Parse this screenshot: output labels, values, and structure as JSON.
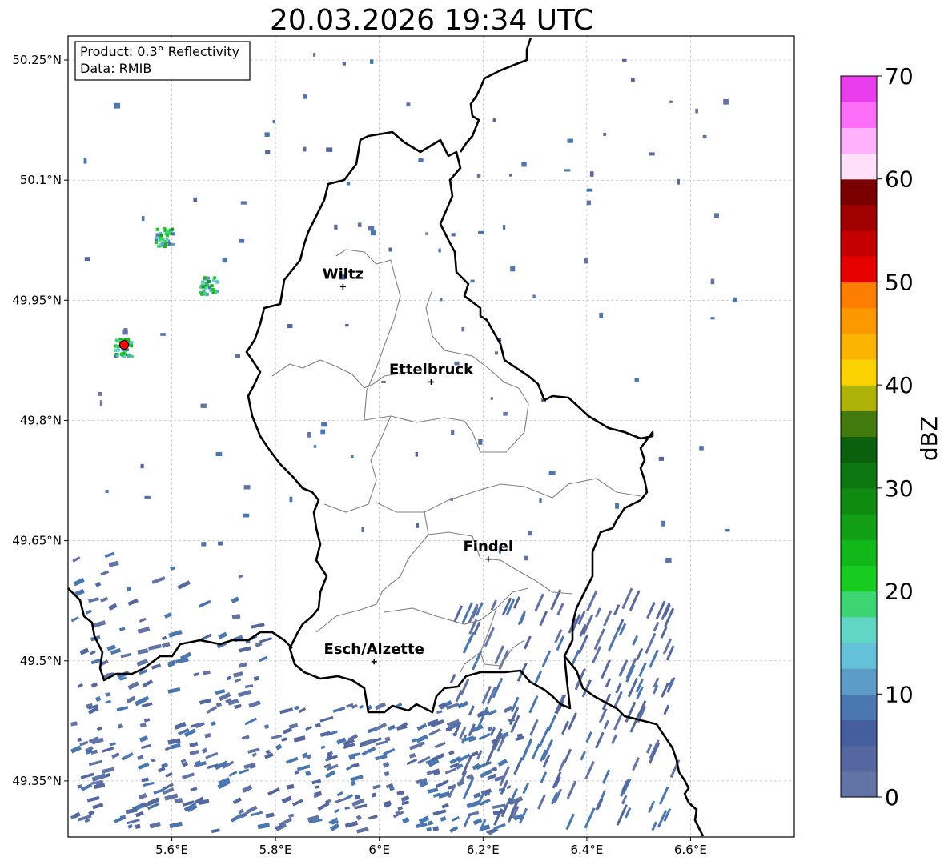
{
  "title": "20.03.2026 19:34 UTC",
  "info_box": {
    "product": "Product: 0.3° Reflectivity",
    "data": "Data: RMIB"
  },
  "map": {
    "lon_range": [
      5.4,
      6.8
    ],
    "lat_range": [
      49.28,
      50.28
    ],
    "lon_ticks": [
      {
        "value": 5.6,
        "label": "5.6°E"
      },
      {
        "value": 5.8,
        "label": "5.8°E"
      },
      {
        "value": 6.0,
        "label": "6°E"
      },
      {
        "value": 6.2,
        "label": "6.2°E"
      },
      {
        "value": 6.4,
        "label": "6.4°E"
      },
      {
        "value": 6.6,
        "label": "6.6°E"
      }
    ],
    "lat_ticks": [
      {
        "value": 50.25,
        "label": "50.25°N"
      },
      {
        "value": 50.1,
        "label": "50.1°N"
      },
      {
        "value": 49.95,
        "label": "49.95°N"
      },
      {
        "value": 49.8,
        "label": "49.8°N"
      },
      {
        "value": 49.65,
        "label": "49.65°N"
      },
      {
        "value": 49.5,
        "label": "49.5°N"
      },
      {
        "value": 49.35,
        "label": "49.35°N"
      }
    ],
    "grid": true,
    "cities": [
      {
        "name": "Wiltz",
        "lon": 5.93,
        "lat": 49.967
      },
      {
        "name": "Ettelbruck",
        "lon": 6.1,
        "lat": 49.848
      },
      {
        "name": "Findel",
        "lon": 6.21,
        "lat": 49.627
      },
      {
        "name": "Esch/Alzette",
        "lon": 5.99,
        "lat": 49.499
      }
    ],
    "radar_site_color": "#ff0000"
  },
  "colorbar": {
    "label": "dBZ",
    "min": 0,
    "max": 70,
    "step": 2.5,
    "ticks": [
      {
        "value": 0,
        "label": "0"
      },
      {
        "value": 10,
        "label": "10"
      },
      {
        "value": 20,
        "label": "20"
      },
      {
        "value": 30,
        "label": "30"
      },
      {
        "value": 40,
        "label": "40"
      },
      {
        "value": 50,
        "label": "50"
      },
      {
        "value": 60,
        "label": "60"
      },
      {
        "value": 70,
        "label": "70"
      }
    ],
    "colors": [
      "#6273a6",
      "#54679e",
      "#455e9e",
      "#4a77af",
      "#5c9cc6",
      "#64c1d9",
      "#61d6c5",
      "#3dd572",
      "#16cc1e",
      "#12b71a",
      "#119f15",
      "#0f8a11",
      "#0c7710",
      "#0a600c",
      "#437a0d",
      "#afb307",
      "#fcd300",
      "#fbb401",
      "#fc9800",
      "#fd7e00",
      "#e60000",
      "#c50000",
      "#a00000",
      "#7a0000",
      "#fee0fa",
      "#feb2fb",
      "#fd6ef8",
      "#e93cec"
    ]
  }
}
